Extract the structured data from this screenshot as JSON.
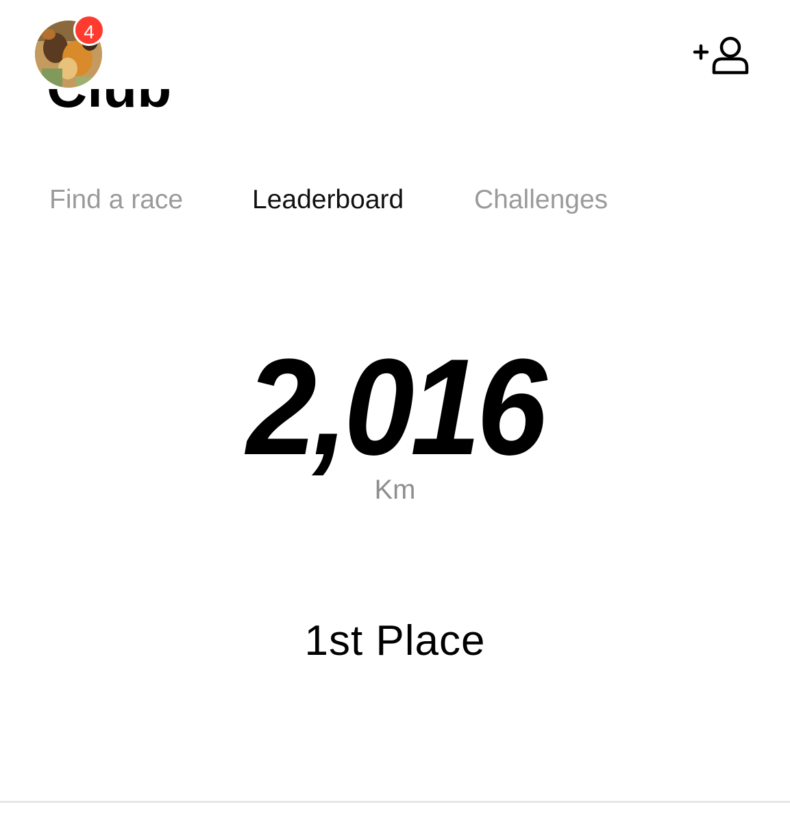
{
  "header": {
    "title": "Club",
    "notification_count": "4"
  },
  "icons": {
    "avatar": "profile-photo",
    "add_friend": "add-person-icon"
  },
  "tabs": [
    {
      "label": "Find a race",
      "active": false
    },
    {
      "label": "Leaderboard",
      "active": true
    },
    {
      "label": "Challenges",
      "active": false
    }
  ],
  "stats": {
    "distance_value": "2,016",
    "distance_unit": "Km",
    "rank": "1st Place"
  },
  "colors": {
    "badge": "#ff3b30",
    "active_tab": "#111111",
    "inactive_tab": "#9a9a9a",
    "unit_text": "#8e8e8e"
  }
}
